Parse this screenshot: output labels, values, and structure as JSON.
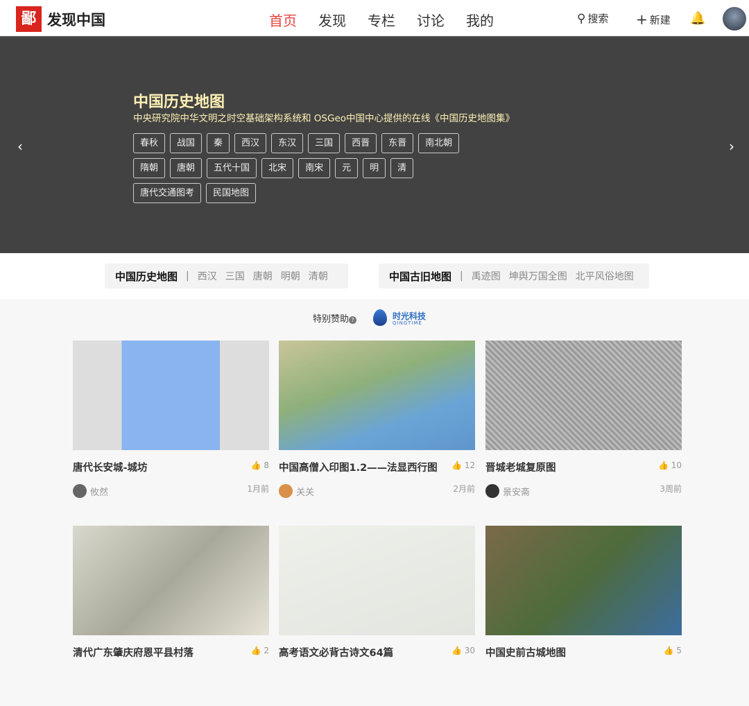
{
  "header": {
    "logo_text": "鄙",
    "brand": "发现中国",
    "nav": [
      "首页",
      "发现",
      "专栏",
      "讨论",
      "我的"
    ],
    "search": "搜索",
    "new": "新建"
  },
  "banner": {
    "title": "中国历史地图",
    "subtitle": "中央研究院中华文明之时空基础架构系统和 OSGeo中国中心提供的在线《中国历史地图集》",
    "rows": [
      [
        "春秋",
        "战国",
        "秦",
        "西汉",
        "东汉",
        "三国",
        "西晋",
        "东晋",
        "南北朝"
      ],
      [
        "隋朝",
        "唐朝",
        "五代十国",
        "北宋",
        "南宋",
        "元",
        "明",
        "清"
      ],
      [
        "唐代交通图考",
        "民国地图"
      ]
    ]
  },
  "categories": [
    {
      "title": "中国历史地图",
      "links": [
        "西汉",
        "三国",
        "唐朝",
        "明朝",
        "清朝"
      ]
    },
    {
      "title": "中国古旧地图",
      "links": [
        "禹迹图",
        "坤舆万国全图",
        "北平风俗地图"
      ]
    }
  ],
  "sponsor": {
    "label": "特别赞助",
    "help": "?",
    "name": "时光科技",
    "name_en": "QINGTIME"
  },
  "cards": [
    {
      "title": "唐代长安城-城坊",
      "likes": "8",
      "author": "攸然",
      "time": "1月前"
    },
    {
      "title": "中国高僧入印图1.2——法显西行图",
      "likes": "12",
      "author": "关关",
      "time": "2月前"
    },
    {
      "title": "晋城老城复原图",
      "likes": "10",
      "author": "景安斋",
      "time": "3周前"
    },
    {
      "title": "清代广东肇庆府恩平县村落",
      "likes": "2"
    },
    {
      "title": "高考语文必背古诗文64篇",
      "likes": "30"
    },
    {
      "title": "中国史前古城地图",
      "likes": "5"
    }
  ]
}
